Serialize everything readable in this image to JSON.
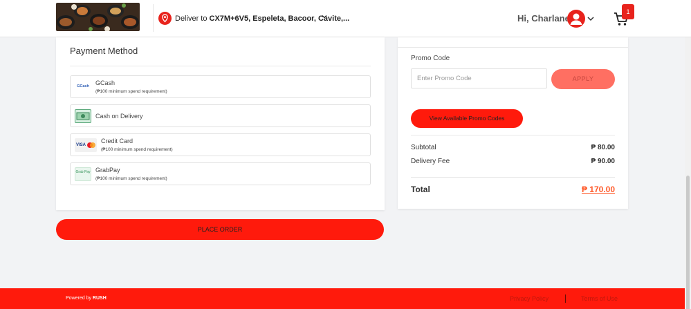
{
  "header": {
    "deliver_prefix": "Deliver to",
    "deliver_address": "CX7M+6V5, Espeleta, Bacoor, Cavite,...",
    "greeting": "Hi, Charlane",
    "cart_count": "1"
  },
  "payment": {
    "title": "Payment Method",
    "methods": [
      {
        "name": "GCash",
        "sub": "(₱100 minimum spend requirement)",
        "icon": "gcash-logo-icon",
        "icon_text": "GCash"
      },
      {
        "name": "Cash on Delivery",
        "icon": "cash-icon"
      },
      {
        "name": "Credit Card",
        "sub": "(₱100 minimum spend requirement)",
        "icon": "visa-mastercard-icon",
        "icon_text": "VISA"
      },
      {
        "name": "GrabPay",
        "sub": "(₱100 minimum spend requirement)",
        "icon": "grabpay-logo-icon",
        "icon_text": "Grab Pay"
      }
    ],
    "place_order": "PLACE ORDER"
  },
  "summary": {
    "promo_label": "Promo Code",
    "promo_placeholder": "Enter Promo Code",
    "apply": "APPLY",
    "view_codes": "View Available Promo Codes",
    "subtotal_label": "Subtotal",
    "subtotal": "₱ 80.00",
    "delivery_label": "Delivery Fee",
    "delivery": "₱ 90.00",
    "total_label": "Total",
    "total": "₱ 170.00"
  },
  "footer": {
    "powered_prefix": "Powered by",
    "powered_brand": "RUSH",
    "privacy": "Privacy Policy",
    "terms": "Terms of Use"
  },
  "colors": {
    "brand_red": "#ff1a0c",
    "accent_orange": "#ff5a2a",
    "apply_disabled": "#ff6f62"
  }
}
